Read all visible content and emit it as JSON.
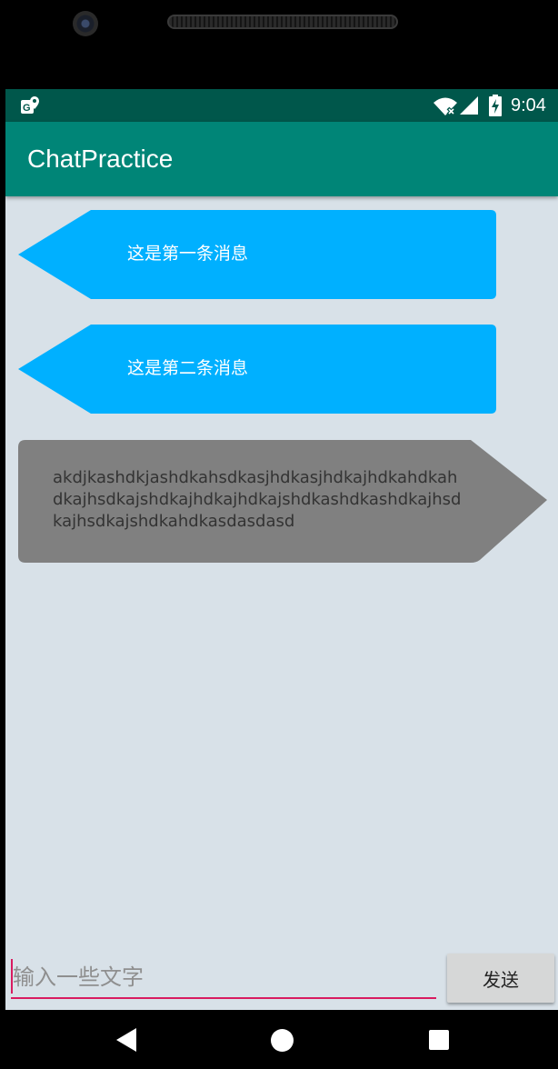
{
  "status_bar": {
    "time": "9:04",
    "icons": [
      "maps-notification-icon",
      "wifi-icon",
      "signal-icon",
      "battery-charging-icon"
    ]
  },
  "app_bar": {
    "title": "ChatPractice",
    "background": "#008577"
  },
  "messages": [
    {
      "direction": "incoming",
      "text": "这是第一条消息",
      "bubble_color": "#00b0ff"
    },
    {
      "direction": "incoming",
      "text": "这是第二条消息",
      "bubble_color": "#00b0ff"
    },
    {
      "direction": "outgoing",
      "text": "akdjkashdkjashdkahsdkasjhdkasjhdkajhdkahdkahdkajhsdkajshdkajhdkajhdkajshdkashdkashdkajhsdkajhsdkajshdkahdkasdasdasd",
      "bubble_color": "#808080"
    }
  ],
  "input": {
    "value": "",
    "placeholder": "输入一些文字",
    "underline_color": "#d81b60"
  },
  "send_button": {
    "label": "发送"
  },
  "nav_bar": {
    "icons": [
      "back-icon",
      "home-icon",
      "recents-icon"
    ]
  }
}
